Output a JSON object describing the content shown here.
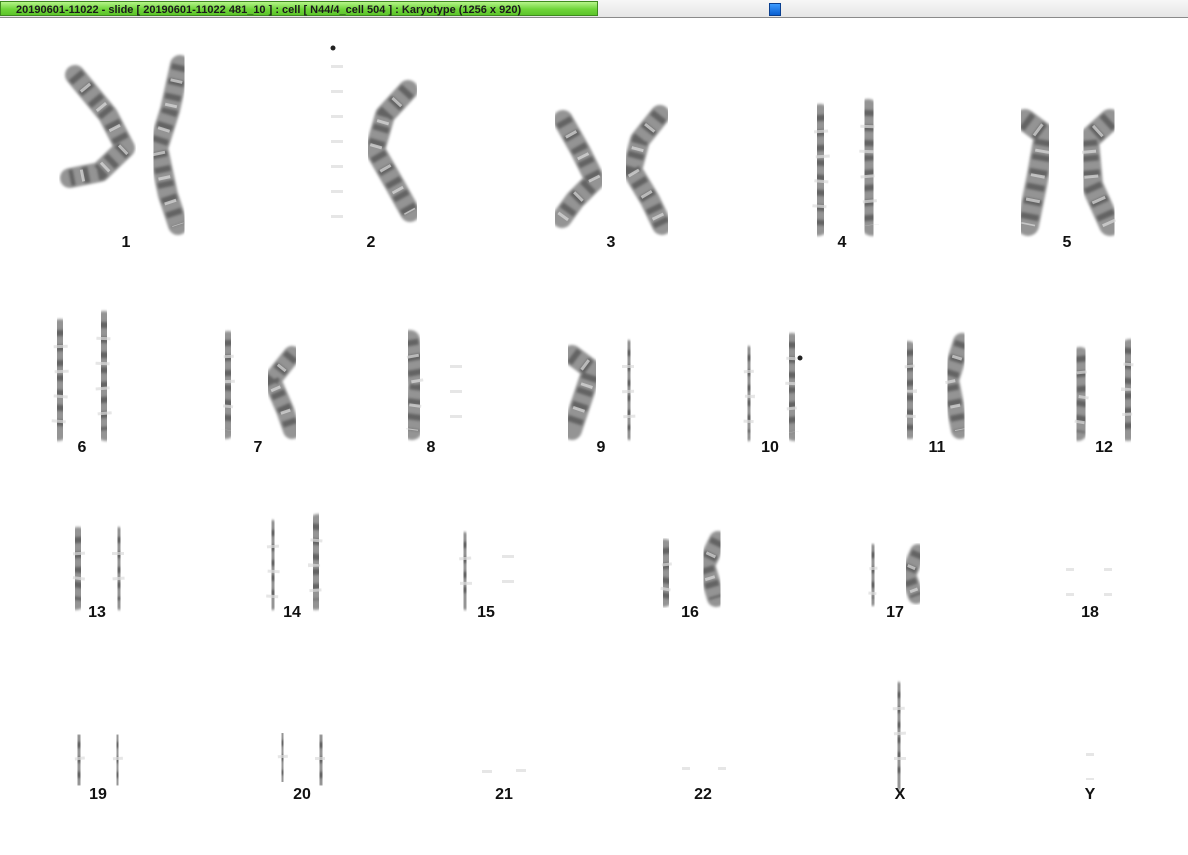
{
  "window": {
    "title": "20190601-11022 - slide [ 20190601-11022 481_10 ] : cell [ N44/4_cell 504 ] : Karyotype  (1256 x 920)"
  },
  "karyotype": {
    "labels": [
      "1",
      "2",
      "3",
      "4",
      "5",
      "6",
      "7",
      "8",
      "9",
      "10",
      "11",
      "12",
      "13",
      "14",
      "15",
      "16",
      "17",
      "18",
      "19",
      "20",
      "21",
      "22",
      "X",
      "Y"
    ]
  },
  "colors": {
    "title_bar": "#6fd53a",
    "marker": "#1f7be6",
    "chromosome": "#777777"
  }
}
